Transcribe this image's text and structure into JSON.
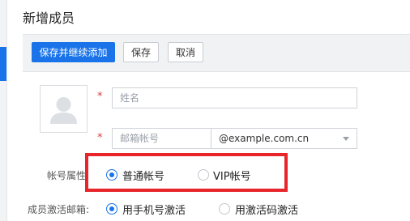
{
  "page": {
    "title": "新增成员"
  },
  "toolbar": {
    "save_and_continue_label": "保存并继续添加",
    "save_label": "保存",
    "cancel_label": "取消"
  },
  "form": {
    "name_placeholder": "姓名",
    "email_placeholder": "邮箱帐号",
    "email_domain": "@example.com.cn",
    "account_type": {
      "label": "帐号属性:",
      "options": [
        "普通帐号",
        "VIP帐号"
      ],
      "selected": "普通帐号"
    },
    "activation": {
      "label": "成员激活邮箱:",
      "options": [
        "用手机号激活",
        "用激活码激活"
      ],
      "selected": "用手机号激活"
    }
  },
  "colors": {
    "primary": "#1a73e8",
    "required": "#e0393e",
    "highlight": "#e8252b"
  }
}
